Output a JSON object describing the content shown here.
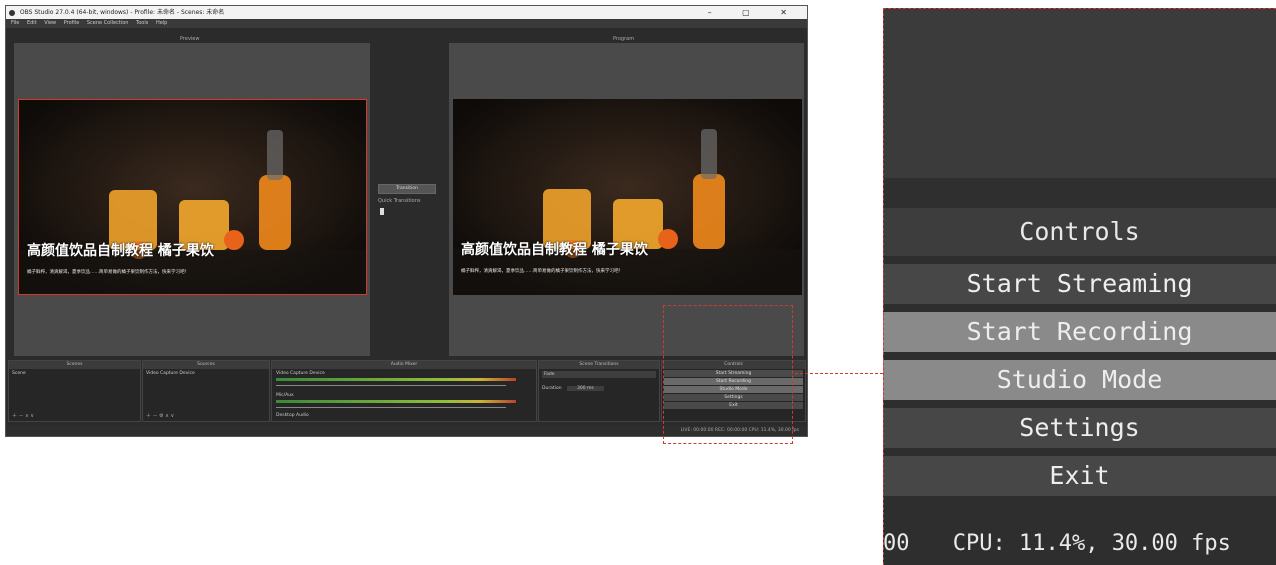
{
  "window": {
    "title": "OBS Studio 27.0.4 (64-bit, windows) - Profile: 未命名 - Scenes: 未命名",
    "controls": "–  ▢  ✕",
    "menu": [
      "File",
      "Edit",
      "View",
      "Profile",
      "Scene Collection",
      "Tools",
      "Help"
    ]
  },
  "canvas": {
    "left_label": "Preview",
    "right_label": "Program",
    "scene_title": "高颜值饮品自制教程 橘子果饮",
    "scene_subtitle": "橘子鲜榨，清爽解渴，夏季饮品……简单易做的橘子果饮制作方法，快来学习吧！"
  },
  "transition": {
    "button": "Transition",
    "quick_label": "Quick Transitions"
  },
  "docks": {
    "scenes": {
      "header": "Scenes",
      "item": "Scene"
    },
    "sources": {
      "header": "Sources",
      "item": "Video Capture Device"
    },
    "mixer": {
      "header": "Audio Mixer",
      "ch1": "Video Capture Device",
      "ch2": "Mic/Aux",
      "ch3": "Desktop Audio"
    },
    "transitions": {
      "header": "Scene Transitions",
      "type": "Fade",
      "duration_label": "Duration",
      "duration": "300 ms"
    },
    "controls": {
      "header": "Controls",
      "buttons": [
        "Start Streaming",
        "Start Recording",
        "Studio Mode",
        "Settings",
        "Exit"
      ]
    }
  },
  "statusbar": "LIVE: 00:00:00   REC: 00:00:00   CPU: 11.4%, 30.00 fps",
  "zoom": {
    "header": "Controls",
    "buttons": [
      "Start Streaming",
      "Start Recording",
      "Studio Mode",
      "Settings",
      "Exit"
    ],
    "status_prefix": "00",
    "status_cpu": "CPU: 11.4%, 30.00 fps"
  },
  "colors": {
    "callout": "#d13b2e",
    "selection": "#d43a2a"
  }
}
